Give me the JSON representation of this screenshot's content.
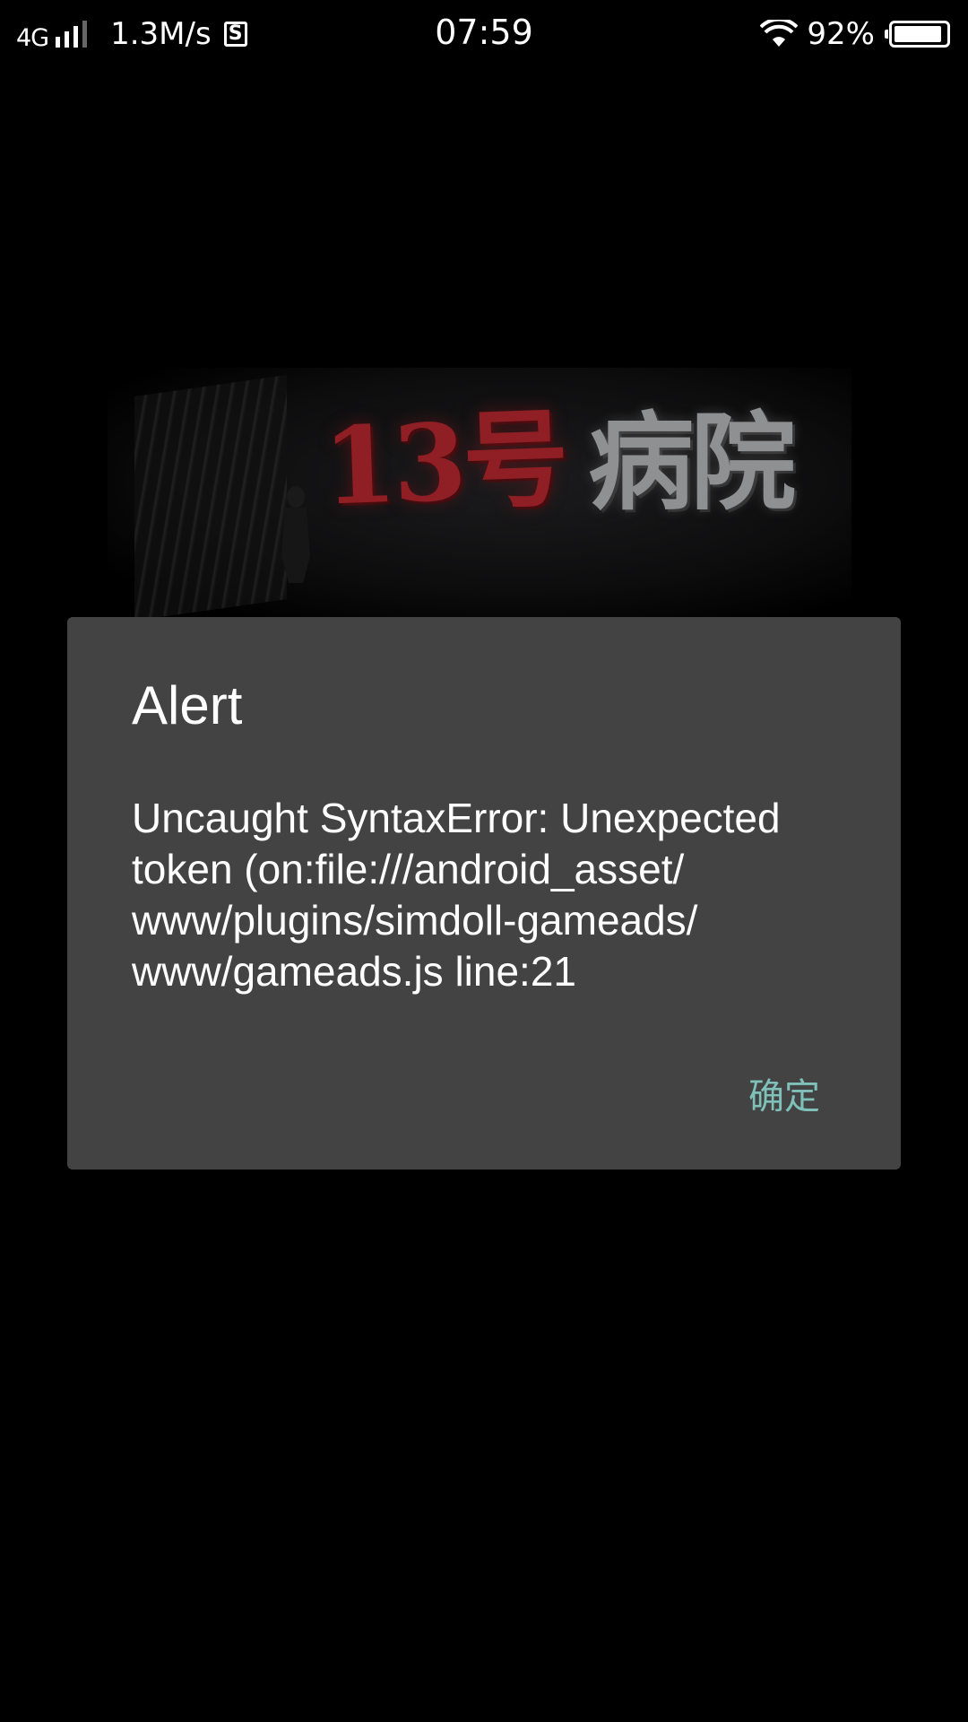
{
  "status_bar": {
    "network": "4G",
    "speed": "1.3M/s",
    "sim_label": "S",
    "time": "07:59",
    "battery_percent_text": "92%",
    "battery_level": 0.92,
    "icons": [
      "signal-icon",
      "sim-icon",
      "wifi-icon",
      "battery-icon"
    ]
  },
  "banner": {
    "title_part1": "13号",
    "title_part2": "病院",
    "colors": {
      "part1": "#8f1f24",
      "part2": "#8e9091"
    }
  },
  "dialog": {
    "title": "Alert",
    "message_lines": [
      "Uncaught SyntaxError: Unexpected",
      "token (on:file:///android_asset/",
      "www/plugins/simdoll-gameads/",
      "www/gameads.js line:21"
    ],
    "confirm_label": "确定",
    "colors": {
      "background": "#434343",
      "button": "#7fc1b9"
    }
  }
}
